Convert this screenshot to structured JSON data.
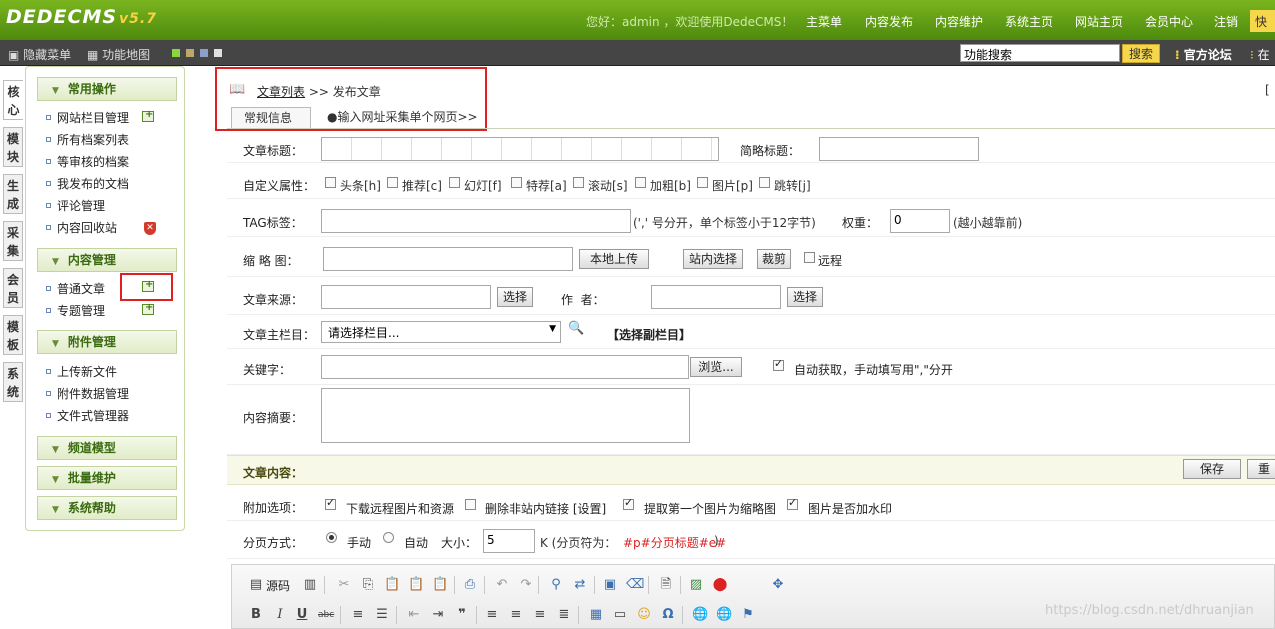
{
  "header": {
    "logo_text": "DEDECMS",
    "logo_version": "v5.7",
    "welcome": "您好：admin ，欢迎使用DedeCMS！",
    "nav": [
      "主菜单",
      "内容发布",
      "内容维护",
      "系统主页",
      "网站主页",
      "会员中心",
      "注销"
    ],
    "quick_label": "快"
  },
  "toolbar": {
    "hide_menu": "隐藏菜单",
    "function_map": "功能地图",
    "search_value": "功能搜索",
    "search_button": "搜索",
    "forum": "官方论坛",
    "forum_tail": "在",
    "theme_colors": [
      "#8bd63c",
      "#bca86a",
      "#8aa0c8",
      "#e0e0e0"
    ]
  },
  "left_tabs": [
    "核心",
    "模块",
    "生成",
    "采集",
    "会员",
    "模板",
    "系统"
  ],
  "sidebar": {
    "sections": [
      {
        "title": "常用操作",
        "items": [
          "网站栏目管理",
          "所有档案列表",
          "等审核的档案",
          "我发布的文档",
          "评论管理",
          "内容回收站"
        ]
      },
      {
        "title": "内容管理",
        "items": [
          "普通文章",
          "专题管理"
        ]
      },
      {
        "title": "附件管理",
        "items": [
          "上传新文件",
          "附件数据管理",
          "文件式管理器"
        ]
      },
      {
        "title": "频道模型",
        "items": []
      },
      {
        "title": "批量维护",
        "items": []
      },
      {
        "title": "系统帮助",
        "items": []
      }
    ]
  },
  "main": {
    "breadcrumb_link": "文章列表",
    "breadcrumb_rest": ">> 发布文章",
    "corner_mark": "[",
    "tabs": [
      "常规信息",
      "●输入网址采集单个网页>>"
    ],
    "form": {
      "title_label": "文章标题：",
      "short_title_label": "简略标题：",
      "custom_attr_label": "自定义属性：",
      "flags": [
        "头条[h]",
        "推荐[c]",
        "幻灯[f]",
        "特荐[a]",
        "滚动[s]",
        "加粗[b]",
        "图片[p]",
        "跳转[j]"
      ],
      "tag_label": "TAG标签：",
      "tag_hint": "(',' 号分开，单个标签小于12字节)",
      "weight_label": "权重：",
      "weight_value": "0",
      "weight_hint": "(越小越靠前)",
      "thumb_label": "缩 略 图：",
      "local_upload": "本地上传",
      "site_select": "站内选择",
      "crop": "裁剪",
      "remote": "远程",
      "source_label": "文章来源：",
      "select_btn": "选择",
      "author_label": "作  者：",
      "author_select": "选择",
      "category_label": "文章主栏目：",
      "category_value": "请选择栏目...",
      "sub_category": "【选择副栏目】",
      "keywords_label": "关键字：",
      "browse": "浏览...",
      "auto_get": "自动获取，手动填写用\",\"分开",
      "summary_label": "内容摘要：",
      "content_label": "文章内容：",
      "save": "保存",
      "save_tail": "重",
      "extra_label": "附加选项：",
      "extras": [
        "下载远程图片和资源",
        "删除非站内链接 [设置]",
        "提取第一个图片为缩略图",
        "图片是否加水印"
      ],
      "paging_label": "分页方式：",
      "manual": "手动",
      "auto": "自动",
      "size_label": "大小：",
      "size_value": "5",
      "size_hint": "K (分页符为：",
      "page_mark": "#p#分页标题#e#",
      "size_hint_end": ")"
    },
    "editor": {
      "source_label": "源码"
    }
  },
  "watermark": "https://blog.csdn.net/dhruanjian"
}
